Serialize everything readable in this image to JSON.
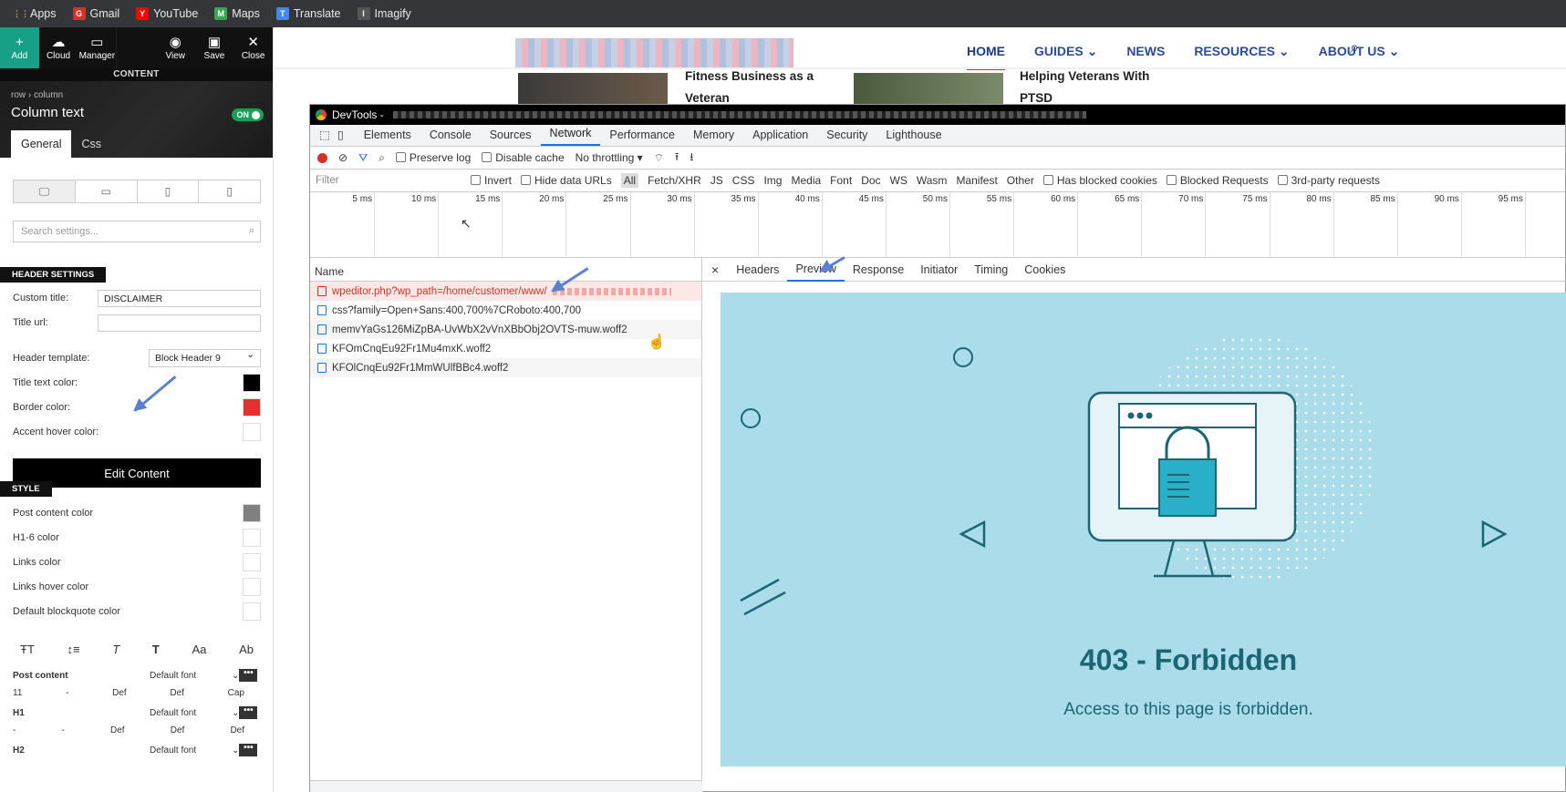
{
  "bookmarks": [
    {
      "label": "Apps",
      "icon": "apps-grid-icon",
      "color": "#e8eaed"
    },
    {
      "label": "Gmail",
      "icon": "gmail-icon",
      "color": "#d93025"
    },
    {
      "label": "YouTube",
      "icon": "youtube-icon",
      "color": "#ff0000"
    },
    {
      "label": "Maps",
      "icon": "maps-pin-icon",
      "color": "#34a853"
    },
    {
      "label": "Translate",
      "icon": "translate-icon",
      "color": "#4285f4"
    },
    {
      "label": "Imagify",
      "icon": "imagify-icon",
      "color": "#555555"
    }
  ],
  "editor": {
    "toolbar": {
      "add": "Add",
      "cloud": "Cloud",
      "manager": "Manager",
      "view": "View",
      "save": "Save",
      "close": "Close"
    },
    "section_label": "CONTENT",
    "breadcrumb": "row › column",
    "title": "Column text",
    "toggle": "ON",
    "tabs": {
      "general": "General",
      "css": "Css"
    },
    "search_placeholder": "Search settings...",
    "header_settings": "HEADER SETTINGS",
    "custom_title_label": "Custom title:",
    "custom_title_value": "DISCLAIMER",
    "title_url_label": "Title url:",
    "header_template_label": "Header template:",
    "header_template_value": "Block Header 9",
    "title_text_color_label": "Title text color:",
    "border_color_label": "Border color:",
    "accent_hover_color_label": "Accent hover color:",
    "edit_content": "Edit Content",
    "style": "STYLE",
    "post_content_color": "Post content color",
    "h16_color": "H1-6 color",
    "links_color": "Links color",
    "links_hover_color": "Links hover color",
    "blockquote_color": "Default blockquote color",
    "typo_rows": [
      {
        "label": "Post content",
        "font": "Default font",
        "vals": [
          "11",
          "-",
          "Def",
          "Def",
          "Cap"
        ]
      },
      {
        "label": "H1",
        "font": "Default font",
        "vals": [
          "-",
          "-",
          "Def",
          "Def",
          "Def"
        ]
      },
      {
        "label": "H2",
        "font": "Default font",
        "vals": []
      }
    ],
    "colors": {
      "title_text": "#000000",
      "border": "#e63030",
      "post_content": "#808080"
    }
  },
  "site": {
    "nav": [
      "HOME",
      "GUIDES",
      "NEWS",
      "RESOURCES",
      "ABOUT US"
    ],
    "article1": [
      "Fitness Business as a",
      "Veteran"
    ],
    "article2": [
      "Helping Veterans With",
      "PTSD"
    ]
  },
  "devtools": {
    "title": "DevTools -",
    "tabs": [
      "Elements",
      "Console",
      "Sources",
      "Network",
      "Performance",
      "Memory",
      "Application",
      "Security",
      "Lighthouse"
    ],
    "active_tab": "Network",
    "preserve_log": "Preserve log",
    "disable_cache": "Disable cache",
    "throttling": "No throttling",
    "filter_placeholder": "Filter",
    "filter_items": [
      "Invert",
      "Hide data URLs",
      "All",
      "Fetch/XHR",
      "JS",
      "CSS",
      "Img",
      "Media",
      "Font",
      "Doc",
      "WS",
      "Wasm",
      "Manifest",
      "Other",
      "Has blocked cookies",
      "Blocked Requests",
      "3rd-party requests"
    ],
    "ticks": [
      "5 ms",
      "10 ms",
      "15 ms",
      "20 ms",
      "25 ms",
      "30 ms",
      "35 ms",
      "40 ms",
      "45 ms",
      "50 ms",
      "55 ms",
      "60 ms",
      "65 ms",
      "70 ms",
      "75 ms",
      "80 ms",
      "85 ms",
      "90 ms",
      "95 ms",
      "10"
    ],
    "name_header": "Name",
    "requests": [
      "wpeditor.php?wp_path=/home/customer/www/",
      "css?family=Open+Sans:400,700%7CRoboto:400,700",
      "memvYaGs126MiZpBA-UvWbX2vVnXBbObj2OVTS-muw.woff2",
      "KFOmCnqEu92Fr1Mu4mxK.woff2",
      "KFOlCnqEu92Fr1MmWUlfBBc4.woff2"
    ],
    "preview_tabs": [
      "Headers",
      "Preview",
      "Response",
      "Initiator",
      "Timing",
      "Cookies"
    ],
    "active_preview": "Preview",
    "error_title": "403 - Forbidden",
    "error_message": "Access to this page is forbidden."
  }
}
